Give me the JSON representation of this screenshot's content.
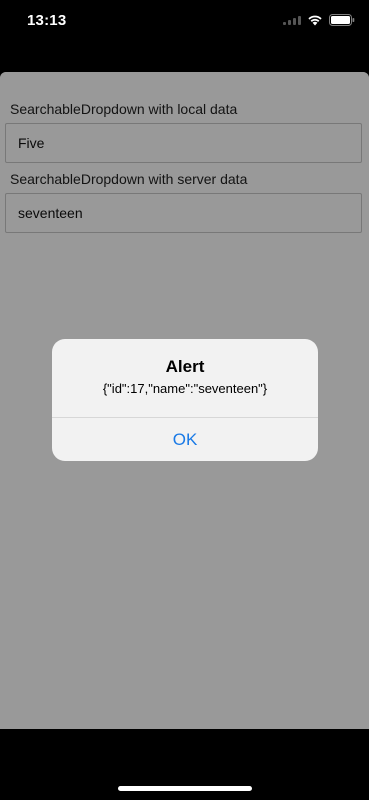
{
  "status_bar": {
    "time": "13:13"
  },
  "app": {
    "local_label": "SearchableDropdown with local data",
    "local_value": "Five",
    "server_label": "SearchableDropdown with server data",
    "server_value": "seventeen"
  },
  "alert": {
    "title": "Alert",
    "message": "{\"id\":17,\"name\":\"seventeen\"}",
    "ok_label": "OK"
  },
  "colors": {
    "accent": "#1a7ae6",
    "overlay": "rgba(0,0,0,0.4)"
  },
  "icons": [
    "cellular-icon",
    "wifi-icon",
    "battery-icon"
  ]
}
